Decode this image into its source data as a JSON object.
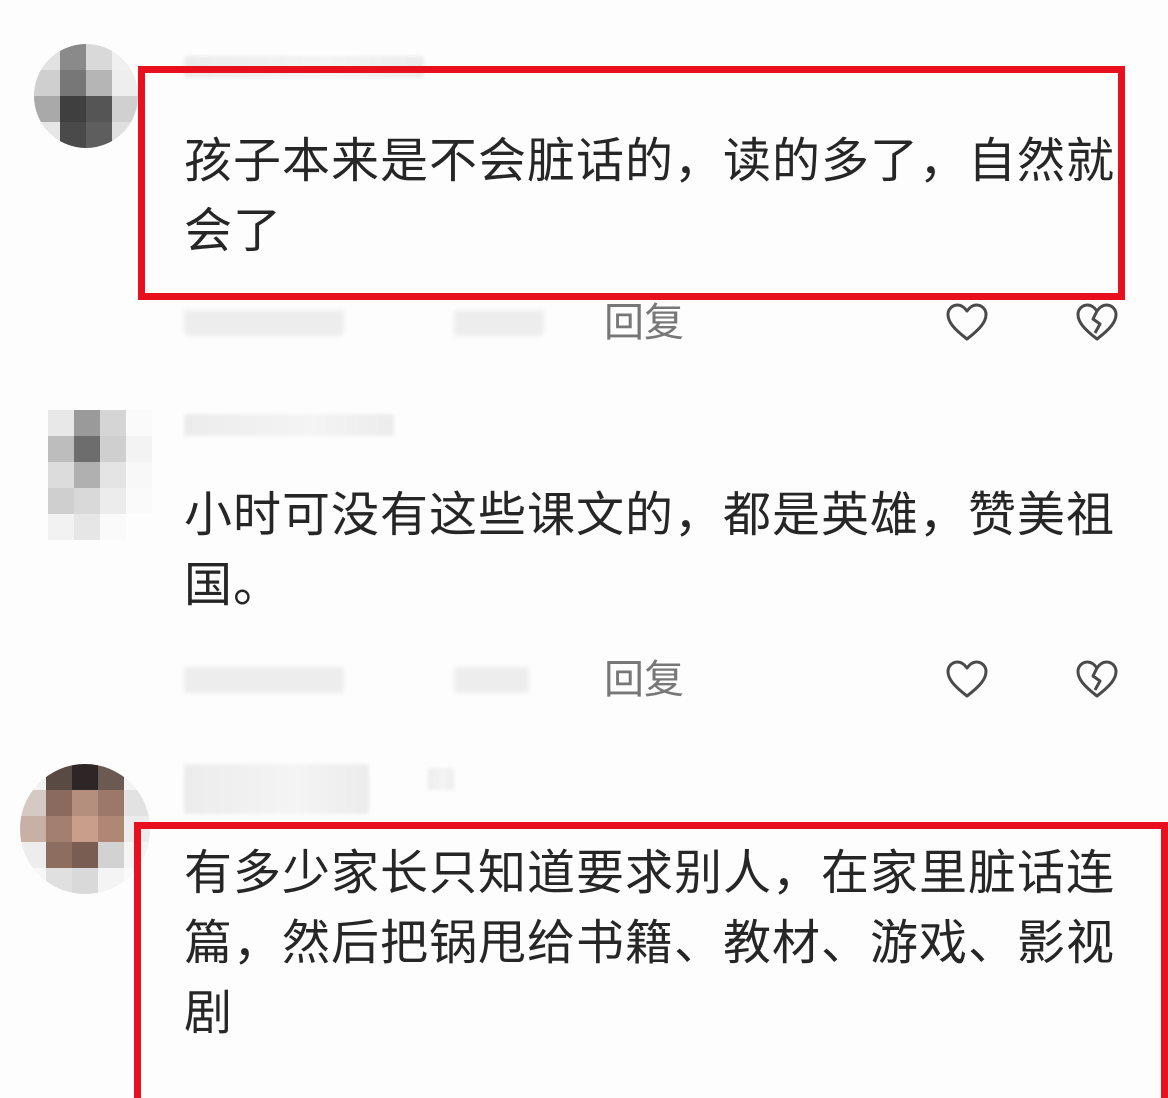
{
  "comments": [
    {
      "text": "孩子本来是不会脏话的，读的多了，自然就会了",
      "reply_label": "回复",
      "like_icon": "heart-outline-icon",
      "dislike_icon": "broken-heart-icon",
      "highlighted": true
    },
    {
      "text": "小时可没有这些课文的，都是英雄，赞美祖国。",
      "reply_label": "回复",
      "like_icon": "heart-outline-icon",
      "dislike_icon": "broken-heart-icon",
      "highlighted": false
    },
    {
      "text": "有多少家长只知道要求别人，在家里脏话连篇，然后把锅甩给书籍、教材、游戏、影视剧",
      "highlighted": true
    }
  ],
  "colors": {
    "highlight_border": "#e8101e",
    "text": "#262626",
    "meta": "#777777"
  }
}
